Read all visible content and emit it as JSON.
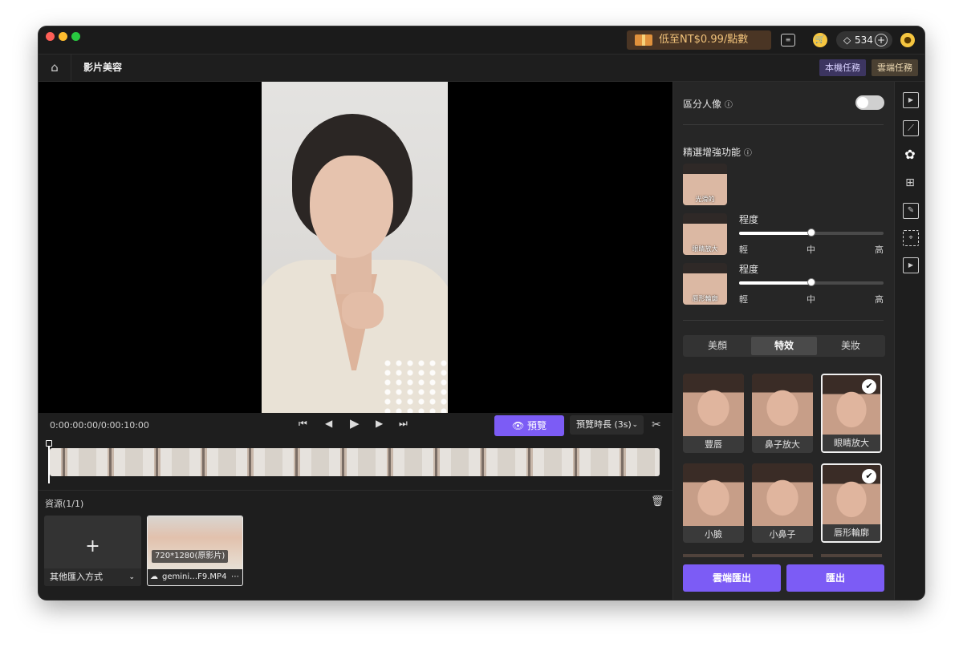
{
  "window": {
    "traffic_lights": [
      "#fe5f57",
      "#febc2e",
      "#28c840"
    ]
  },
  "topbar": {
    "promo_text": "低至NT$0.99/點數",
    "credits": "534",
    "icons": [
      "gift-icon",
      "message-icon",
      "cart-icon",
      "diamond-icon",
      "plus-icon",
      "user-icon"
    ]
  },
  "nav": {
    "title": "影片美容",
    "local_tasks": "本機任務",
    "cloud_tasks": "雲端任務"
  },
  "player": {
    "timecode": "0:00:00:00/0:00:10:00",
    "preview_label": "預覽",
    "duration_label": "預覽時長 (3s)"
  },
  "resources": {
    "title": "資源(1/1)",
    "import_label": "其他匯入方式",
    "clip_resolution": "720*1280(原影片)",
    "clip_name": "gemini…F9.MP4"
  },
  "panel": {
    "separate_portrait": "區分人像",
    "separate_portrait_on": false,
    "featured_title": "精選增強功能",
    "featured": [
      {
        "label": "光滑的"
      },
      {
        "label": "眼睛放大",
        "slider_title": "程度",
        "level": 0.5,
        "ticks": [
          "輕",
          "中",
          "高"
        ]
      },
      {
        "label": "唇形輪廓",
        "slider_title": "程度",
        "level": 0.5,
        "ticks": [
          "輕",
          "中",
          "高"
        ]
      }
    ],
    "tabs": [
      "美顏",
      "特效",
      "美妝"
    ],
    "active_tab": "特效",
    "effects": [
      {
        "label": "豐唇",
        "selected": false
      },
      {
        "label": "鼻子放大",
        "selected": false
      },
      {
        "label": "眼睛放大",
        "selected": true
      },
      {
        "label": "小臉",
        "selected": false
      },
      {
        "label": "小鼻子",
        "selected": false
      },
      {
        "label": "唇形輪廓",
        "selected": true
      }
    ],
    "cloud_export": "雲端匯出",
    "export": "匯出"
  },
  "colors": {
    "accent": "#7c5cf5",
    "panel": "#262626",
    "background": "#1e1e1e"
  }
}
